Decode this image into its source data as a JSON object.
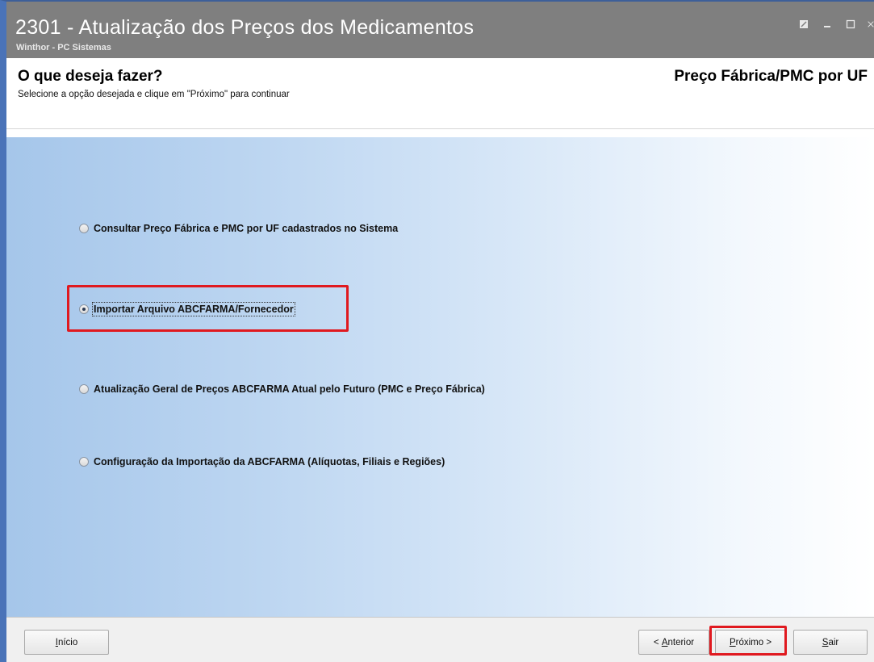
{
  "window": {
    "title": "2301 - Atualização dos Preços dos Medicamentos",
    "subtitle": "Winthor - PC Sistemas",
    "controls": [
      "restore-icon",
      "minimize-icon",
      "maximize-icon",
      "close-icon"
    ]
  },
  "header": {
    "title": "O que deseja fazer?",
    "description": "Selecione a opção desejada e clique em \"Próximo\" para continuar",
    "right_title": "Preço Fábrica/PMC por UF"
  },
  "options": [
    {
      "label": "Consultar Preço Fábrica e PMC por UF cadastrados no Sistema",
      "selected": false
    },
    {
      "label": "Importar Arquivo ABCFARMA/Fornecedor",
      "selected": true
    },
    {
      "label": "Atualização Geral de Preços ABCFARMA Atual pelo Futuro (PMC e Preço Fábrica)",
      "selected": false
    },
    {
      "label": "Configuração da Importação da ABCFARMA (Alíquotas, Filiais e Regiões)",
      "selected": false
    }
  ],
  "footer": {
    "inicio": {
      "accel": "I",
      "rest": "nício"
    },
    "anterior": {
      "pre": "< ",
      "accel": "A",
      "rest": "nterior"
    },
    "proximo": {
      "accel": "P",
      "rest": "róximo >"
    },
    "sair": {
      "accel": "S",
      "rest": "air"
    }
  },
  "colors": {
    "highlight": "#e0191f",
    "titlebar": "#7f7f7f",
    "window_border": "#4a73b8"
  }
}
